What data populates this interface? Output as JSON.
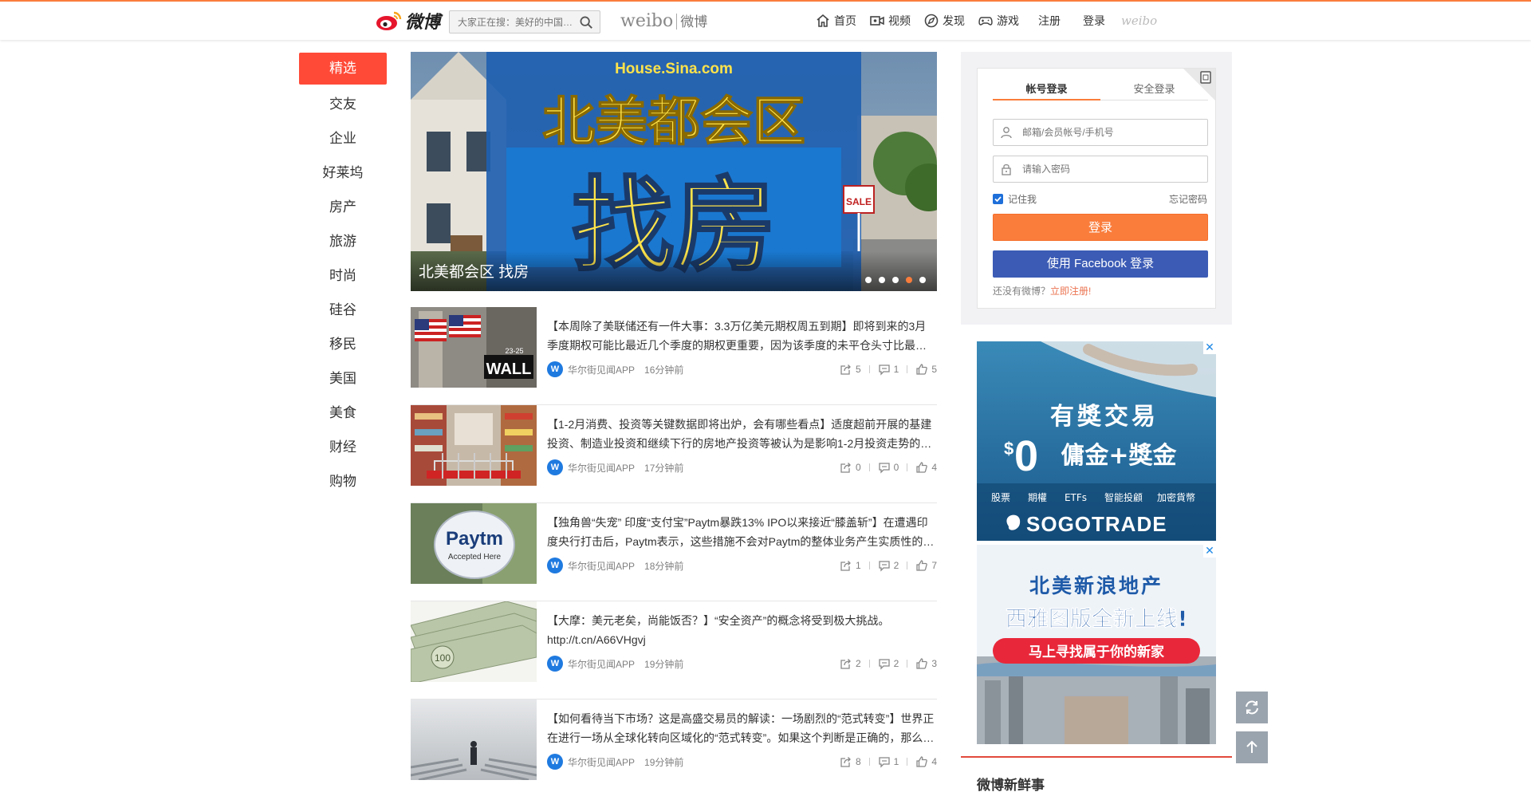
{
  "header": {
    "logo_text": "微博",
    "search_placeholder": "大家正在搜：美好的中国…",
    "brand_en": "weibo",
    "brand_cn": "微博",
    "nav": [
      {
        "label": "首页",
        "icon": "home-icon"
      },
      {
        "label": "视频",
        "icon": "video-icon"
      },
      {
        "label": "发现",
        "icon": "compass-icon"
      },
      {
        "label": "游戏",
        "icon": "gamepad-icon"
      }
    ],
    "register": "注册",
    "login": "登录",
    "small_logo": "weibo"
  },
  "leftnav": [
    "精选",
    "交友",
    "企业",
    "好莱坞",
    "房产",
    "旅游",
    "时尚",
    "硅谷",
    "移民",
    "美国",
    "美食",
    "财经",
    "购物"
  ],
  "carousel": {
    "site": "House.Sina.com",
    "headline_top": "北美都会区",
    "headline_big": "找房",
    "sale_sign": "SALE",
    "caption": "北美都会区 找房",
    "dots": 5,
    "active_dot": 3
  },
  "feed": [
    {
      "text": "【本周除了美联储还有一件大事：3.3万亿美元期权周五到期】即将到来的3月季度期权可能比最近几个季度的期权更重要，因为该季度的未平仓头寸比最…",
      "source": "华尔街见闻APP",
      "time": "16分钟前",
      "reposts": "5",
      "comments": "1",
      "likes": "5",
      "thumb": "wall-street"
    },
    {
      "text": "【1-2月消费、投资等关键数据即将出炉，会有哪些看点】适度超前开展的基建投资、制造业投资和继续下行的房地产投资等被认为是影响1-2月投资走势的…",
      "source": "华尔街见闻APP",
      "time": "17分钟前",
      "reposts": "0",
      "comments": "0",
      "likes": "4",
      "thumb": "shopping-cart"
    },
    {
      "text": "【独角兽“失宠” 印度“支付宝”Paytm暴跌13% IPO以来接近“膝盖斩”】在遭遇印度央行打击后，Paytm表示，这些措施不会对Paytm的整体业务产生实质性的…",
      "source": "华尔街见闻APP",
      "time": "18分钟前",
      "reposts": "1",
      "comments": "2",
      "likes": "7",
      "thumb": "paytm"
    },
    {
      "text": "【大摩：美元老矣，尚能饭否？】“安全资产”的概念将受到极大挑战。 http://t.cn/A66VHgvj",
      "source": "华尔街见闻APP",
      "time": "19分钟前",
      "reposts": "2",
      "comments": "2",
      "likes": "3",
      "thumb": "dollars"
    },
    {
      "text": "【如何看待当下市场？这是高盛交易员的解读：一场剧烈的“范式转变”】世界正在进行一场从全球化转向区域化的“范式转变”。如果这个判断是正确的，那么…",
      "source": "华尔街见闻APP",
      "time": "19分钟前",
      "reposts": "8",
      "comments": "1",
      "likes": "4",
      "thumb": "maze"
    }
  ],
  "feed_thumb_text": {
    "wall": "WALL",
    "street_num": "23-25",
    "paytm": "Paytm",
    "accepted": "Accepted Here"
  },
  "login": {
    "tab_account": "帐号登录",
    "tab_secure": "安全登录",
    "username_placeholder": "邮箱/会员帐号/手机号",
    "password_placeholder": "请输入密码",
    "remember": "记住我",
    "forgot": "忘记密码",
    "login_btn": "登录",
    "facebook_btn": "使用 Facebook 登录",
    "no_account": "还没有微博？",
    "register_now": "立即注册!"
  },
  "ad1": {
    "line1": "有獎交易",
    "line2_zero": "0",
    "line2_rest": "傭金+獎金",
    "currency": "$",
    "products": [
      "股票",
      "期權",
      "ETFs",
      "智能投顧",
      "加密貨幣"
    ],
    "brand": "SOGOTRADE"
  },
  "ad2": {
    "line1": "北美新浪地产",
    "line2": "西雅图版全新上线!",
    "cta": "马上寻找属于你的新家"
  },
  "ad_close": "✕",
  "news_section_title": "微博新鲜事",
  "colors": {
    "accent": "#fa7d3c",
    "active_nav": "#ff4a37",
    "facebook": "#3b5bb5",
    "link": "#eb7350"
  }
}
